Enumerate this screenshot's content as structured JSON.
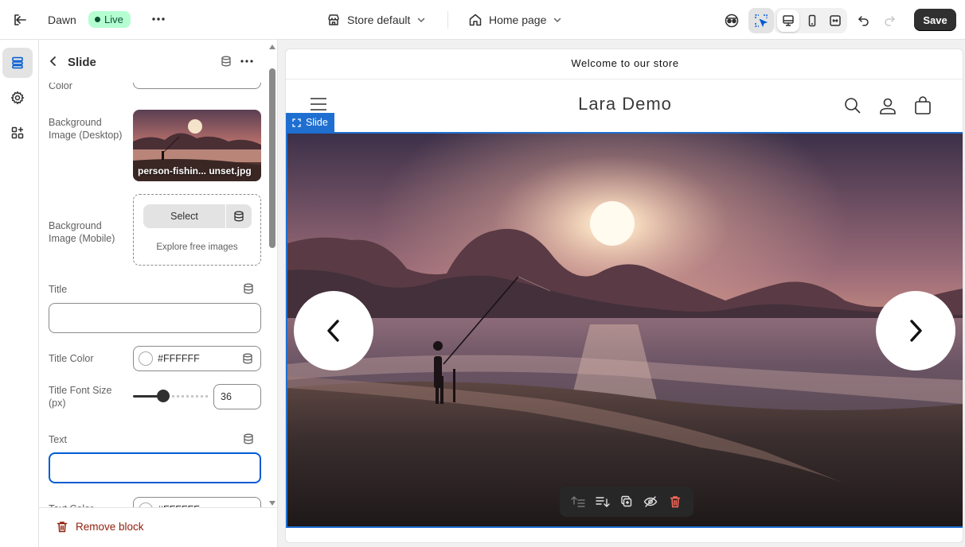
{
  "topbar": {
    "theme_name": "Dawn",
    "status_badge": "Live",
    "store_selector": "Store default",
    "page_selector": "Home page",
    "save_label": "Save"
  },
  "panel": {
    "title": "Slide",
    "partial_label": "Color",
    "bg_desktop_label": "Background Image (Desktop)",
    "bg_desktop_filename": "person-fishin... unset.jpg",
    "bg_mobile_label": "Background Image (Mobile)",
    "select_label": "Select",
    "explore_label": "Explore free images",
    "title_label": "Title",
    "title_value": "",
    "title_color_label": "Title Color",
    "title_color_value": "#FFFFFF",
    "title_font_size_label": "Title Font Size (px)",
    "title_font_size_value": "36",
    "title_font_size_fraction": 0.4,
    "text_label": "Text",
    "text_value": "",
    "text_color_label": "Text Color",
    "text_color_value": "#FFFFFF",
    "remove_label": "Remove block"
  },
  "preview": {
    "announcement": "Welcome to our store",
    "brand": "Lara Demo",
    "selected_block_label": "Slide"
  },
  "colors": {
    "accent": "#1f6fd1",
    "live_badge_bg": "#b4fed2",
    "remove_red": "#8e1f0b",
    "save_bg": "#303030"
  }
}
